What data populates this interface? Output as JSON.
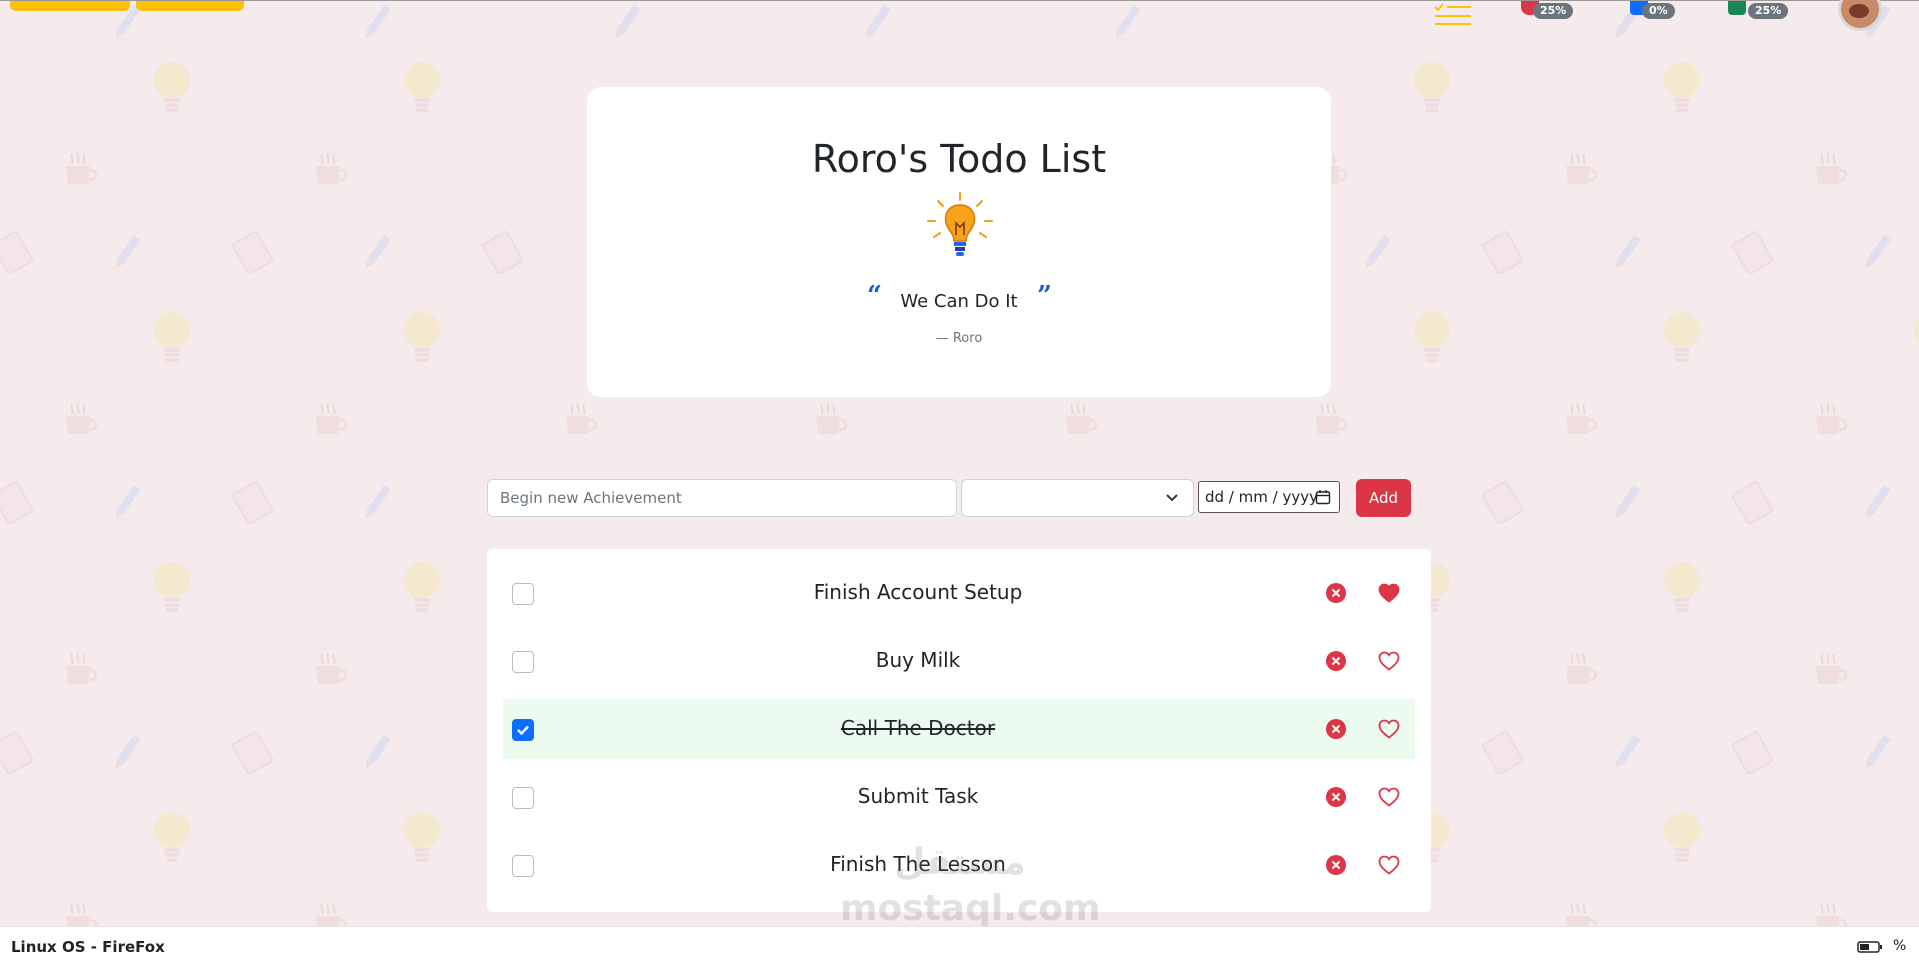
{
  "app": {
    "title": "Roro's Todo List",
    "quote": "We Can Do It",
    "quote_author": "— Roro",
    "open_quote": "“",
    "close_quote": "”"
  },
  "topbar": {
    "stats": [
      {
        "icon": "heart-icon",
        "color": "#dc3545",
        "value": "25%"
      },
      {
        "icon": "blue-square-icon",
        "color": "#0d6efd",
        "value": "0%"
      },
      {
        "icon": "check-icon",
        "color": "#198754",
        "value": "25%"
      }
    ]
  },
  "form": {
    "task_placeholder": "Begin new Achievement",
    "date_placeholder": "dd / mm / yyyy",
    "add_label": "Add"
  },
  "todos": [
    {
      "text": "Finish Account Setup",
      "done": false,
      "favorite": true
    },
    {
      "text": "Buy Milk",
      "done": false,
      "favorite": false
    },
    {
      "text": "Call The Doctor",
      "done": true,
      "favorite": false
    },
    {
      "text": "Submit Task",
      "done": false,
      "favorite": false
    },
    {
      "text": "Finish The Lesson",
      "done": false,
      "favorite": false
    }
  ],
  "watermark": {
    "line1": "مستقل",
    "line2": "mostaql.com"
  },
  "statusbar": {
    "label": "Linux OS - FireFox",
    "battery_suffix": "%"
  },
  "colors": {
    "background": "#f5ebed",
    "accent_red": "#dc3545",
    "accent_blue": "#0d6efd",
    "accent_yellow": "#ffc107",
    "done_row": "#ebfbef"
  }
}
